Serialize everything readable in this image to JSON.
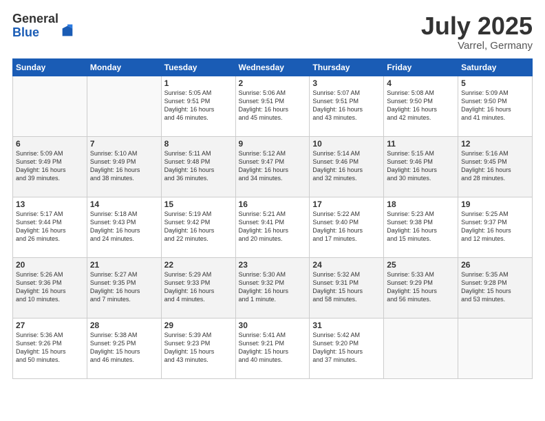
{
  "logo": {
    "general": "General",
    "blue": "Blue"
  },
  "title": {
    "month": "July 2025",
    "location": "Varrel, Germany"
  },
  "headers": [
    "Sunday",
    "Monday",
    "Tuesday",
    "Wednesday",
    "Thursday",
    "Friday",
    "Saturday"
  ],
  "weeks": [
    [
      {
        "day": "",
        "info": ""
      },
      {
        "day": "",
        "info": ""
      },
      {
        "day": "1",
        "info": "Sunrise: 5:05 AM\nSunset: 9:51 PM\nDaylight: 16 hours\nand 46 minutes."
      },
      {
        "day": "2",
        "info": "Sunrise: 5:06 AM\nSunset: 9:51 PM\nDaylight: 16 hours\nand 45 minutes."
      },
      {
        "day": "3",
        "info": "Sunrise: 5:07 AM\nSunset: 9:51 PM\nDaylight: 16 hours\nand 43 minutes."
      },
      {
        "day": "4",
        "info": "Sunrise: 5:08 AM\nSunset: 9:50 PM\nDaylight: 16 hours\nand 42 minutes."
      },
      {
        "day": "5",
        "info": "Sunrise: 5:09 AM\nSunset: 9:50 PM\nDaylight: 16 hours\nand 41 minutes."
      }
    ],
    [
      {
        "day": "6",
        "info": "Sunrise: 5:09 AM\nSunset: 9:49 PM\nDaylight: 16 hours\nand 39 minutes."
      },
      {
        "day": "7",
        "info": "Sunrise: 5:10 AM\nSunset: 9:49 PM\nDaylight: 16 hours\nand 38 minutes."
      },
      {
        "day": "8",
        "info": "Sunrise: 5:11 AM\nSunset: 9:48 PM\nDaylight: 16 hours\nand 36 minutes."
      },
      {
        "day": "9",
        "info": "Sunrise: 5:12 AM\nSunset: 9:47 PM\nDaylight: 16 hours\nand 34 minutes."
      },
      {
        "day": "10",
        "info": "Sunrise: 5:14 AM\nSunset: 9:46 PM\nDaylight: 16 hours\nand 32 minutes."
      },
      {
        "day": "11",
        "info": "Sunrise: 5:15 AM\nSunset: 9:46 PM\nDaylight: 16 hours\nand 30 minutes."
      },
      {
        "day": "12",
        "info": "Sunrise: 5:16 AM\nSunset: 9:45 PM\nDaylight: 16 hours\nand 28 minutes."
      }
    ],
    [
      {
        "day": "13",
        "info": "Sunrise: 5:17 AM\nSunset: 9:44 PM\nDaylight: 16 hours\nand 26 minutes."
      },
      {
        "day": "14",
        "info": "Sunrise: 5:18 AM\nSunset: 9:43 PM\nDaylight: 16 hours\nand 24 minutes."
      },
      {
        "day": "15",
        "info": "Sunrise: 5:19 AM\nSunset: 9:42 PM\nDaylight: 16 hours\nand 22 minutes."
      },
      {
        "day": "16",
        "info": "Sunrise: 5:21 AM\nSunset: 9:41 PM\nDaylight: 16 hours\nand 20 minutes."
      },
      {
        "day": "17",
        "info": "Sunrise: 5:22 AM\nSunset: 9:40 PM\nDaylight: 16 hours\nand 17 minutes."
      },
      {
        "day": "18",
        "info": "Sunrise: 5:23 AM\nSunset: 9:38 PM\nDaylight: 16 hours\nand 15 minutes."
      },
      {
        "day": "19",
        "info": "Sunrise: 5:25 AM\nSunset: 9:37 PM\nDaylight: 16 hours\nand 12 minutes."
      }
    ],
    [
      {
        "day": "20",
        "info": "Sunrise: 5:26 AM\nSunset: 9:36 PM\nDaylight: 16 hours\nand 10 minutes."
      },
      {
        "day": "21",
        "info": "Sunrise: 5:27 AM\nSunset: 9:35 PM\nDaylight: 16 hours\nand 7 minutes."
      },
      {
        "day": "22",
        "info": "Sunrise: 5:29 AM\nSunset: 9:33 PM\nDaylight: 16 hours\nand 4 minutes."
      },
      {
        "day": "23",
        "info": "Sunrise: 5:30 AM\nSunset: 9:32 PM\nDaylight: 16 hours\nand 1 minute."
      },
      {
        "day": "24",
        "info": "Sunrise: 5:32 AM\nSunset: 9:31 PM\nDaylight: 15 hours\nand 58 minutes."
      },
      {
        "day": "25",
        "info": "Sunrise: 5:33 AM\nSunset: 9:29 PM\nDaylight: 15 hours\nand 56 minutes."
      },
      {
        "day": "26",
        "info": "Sunrise: 5:35 AM\nSunset: 9:28 PM\nDaylight: 15 hours\nand 53 minutes."
      }
    ],
    [
      {
        "day": "27",
        "info": "Sunrise: 5:36 AM\nSunset: 9:26 PM\nDaylight: 15 hours\nand 50 minutes."
      },
      {
        "day": "28",
        "info": "Sunrise: 5:38 AM\nSunset: 9:25 PM\nDaylight: 15 hours\nand 46 minutes."
      },
      {
        "day": "29",
        "info": "Sunrise: 5:39 AM\nSunset: 9:23 PM\nDaylight: 15 hours\nand 43 minutes."
      },
      {
        "day": "30",
        "info": "Sunrise: 5:41 AM\nSunset: 9:21 PM\nDaylight: 15 hours\nand 40 minutes."
      },
      {
        "day": "31",
        "info": "Sunrise: 5:42 AM\nSunset: 9:20 PM\nDaylight: 15 hours\nand 37 minutes."
      },
      {
        "day": "",
        "info": ""
      },
      {
        "day": "",
        "info": ""
      }
    ]
  ]
}
